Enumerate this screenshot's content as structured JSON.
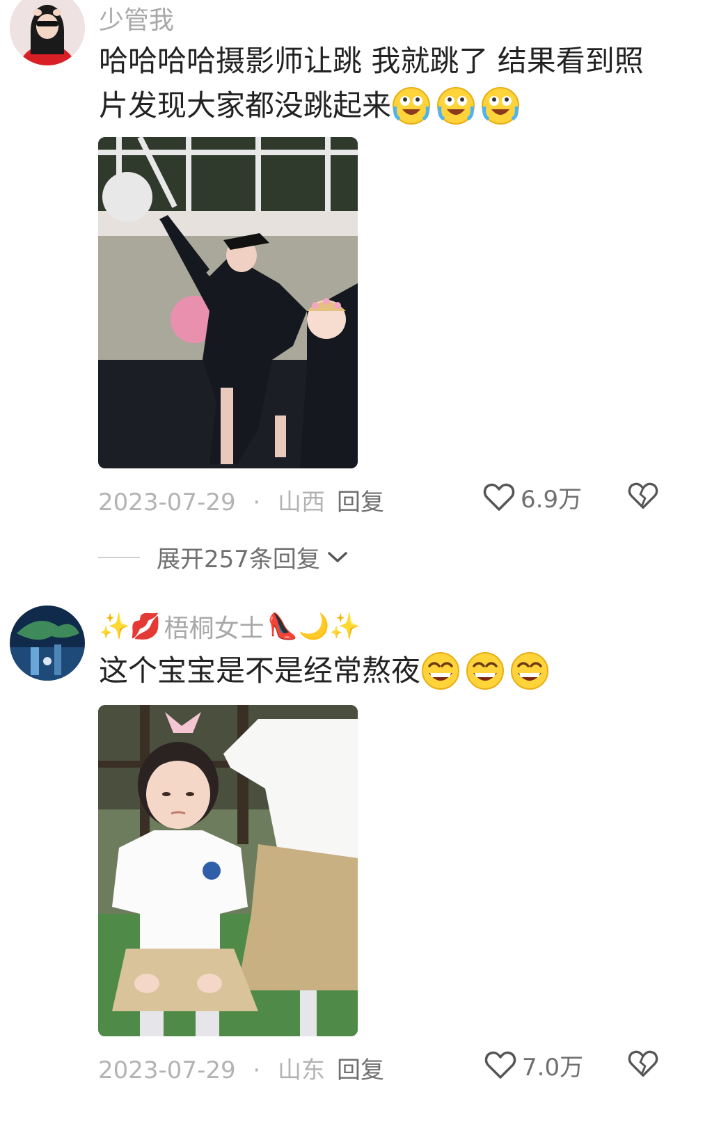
{
  "comments": [
    {
      "username": "少管我",
      "text_line1": "哈哈哈哈摄影师让跳 我就跳了 结果看到照",
      "text_line2": "片发现大家都没跳起来",
      "emoji": "crying-laugh",
      "date": "2023-07-29",
      "location": "山西",
      "separator": "·",
      "reply_label": "回复",
      "likes": "6.9万",
      "expand_label": "展开257条回复"
    },
    {
      "username_prefix_emojis": "✨💋",
      "username": "梧桐女士",
      "username_suffix_emojis": "👠🌙✨",
      "text": "这个宝宝是不是经常熬夜",
      "emoji": "grinning-squint",
      "date": "2023-07-29",
      "location": "山东",
      "separator": "·",
      "reply_label": "回复",
      "likes": "7.0万"
    }
  ]
}
